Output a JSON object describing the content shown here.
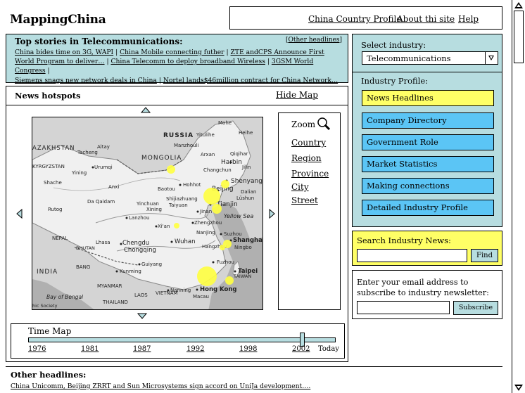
{
  "site": {
    "logo": "MappingChina"
  },
  "nav": {
    "links": [
      "China Country Profile",
      "About thi site",
      "Help"
    ]
  },
  "top_stories": {
    "title": "Top stories in Telecommunications:",
    "other_link": "Other headlines",
    "headlines": [
      "China bides time on 3G, WAPI",
      "China Mobile connecting futher",
      "ZTE andCPS Announce First World Program to deliver…",
      "China Telecomm to deploy broadband Wireless",
      "3GSM World Congress",
      "Siemens snags new network deals in China",
      "Nortel lands$46million contract for China Network…"
    ]
  },
  "hotspots": {
    "title": "News hotspots",
    "hide_map": "Hide Map",
    "zoom": {
      "label": "Zoom",
      "options": [
        "Country",
        "Region",
        "Province",
        "City",
        "Street"
      ]
    },
    "timemap": {
      "label": "Time Map",
      "years": [
        "1976",
        "1981",
        "1987",
        "1992",
        "1998",
        "2002"
      ],
      "today": "Today",
      "selected": "2002"
    },
    "map": {
      "countries": [
        "RUSSIA",
        "MONGOLIA",
        "AZAKHSTAN",
        "KYRGYZSTAN",
        "NEPAL",
        "BHUTAN",
        "INDIA",
        "BANG",
        "MYANMAR",
        "LAOS",
        "THAILAND",
        "VIETNAM",
        "TAIWAN"
      ],
      "cities": [
        "Harbin",
        "Shenyang",
        "Beijing",
        "Tianjin",
        "Shijiazhuang",
        "Taiyuan",
        "Jinan",
        "Zhengzhou",
        "Xi'an",
        "Lanzhou",
        "Xining",
        "Yinchuan",
        "Hohhot",
        "Baotou",
        "Changchun",
        "Jilin",
        "Qiqihar",
        "Heihe",
        "Mohe",
        "Manzhouli",
        "Yitulihe",
        "Arxan",
        "Urumqi",
        "Altay",
        "Tacheng",
        "Yining",
        "Anxi",
        "Da Qaidam",
        "Shache",
        "Rutog",
        "Lhasa",
        "Chengdu",
        "Chongqing",
        "Wuhan",
        "Nanjing",
        "Suzhou",
        "Shanghai",
        "Hangzhou",
        "Ningbo",
        "Fuzhou",
        "Taipei",
        "Guiyang",
        "Kunming",
        "Nanning",
        "Hong Kong",
        "Macau",
        "Lüshun",
        "Dalian"
      ],
      "seas": [
        "Bay of Bengal",
        "Yellow Sea"
      ],
      "credit": "hic Society",
      "hotspots": [
        {
          "name": "Beijing",
          "size": "large"
        },
        {
          "name": "Tianjin",
          "size": "medium"
        },
        {
          "name": "Shenyang",
          "size": "small"
        },
        {
          "name": "Shanghai",
          "size": "medium"
        },
        {
          "name": "Hong Kong",
          "size": "large"
        },
        {
          "name": "Xi'an",
          "size": "small"
        },
        {
          "name": "Western China",
          "size": "small"
        }
      ],
      "hotspot_color": "#ffff44"
    }
  },
  "other_headlines": {
    "title": "Other headlines:",
    "text": "China Unicomm, Beijing ZRRT and Sun Microsystems sign accord on UniJa development…."
  },
  "industry": {
    "select_label": "Select industry:",
    "selected": "Telecommunications",
    "profile_label": "Industry Profile:",
    "profile_items": [
      "News Headlines",
      "Company Directory",
      "Government Role",
      "Market Statistics",
      "Making connections",
      "Detailed Industry Profile"
    ],
    "active_item": "News Headlines"
  },
  "search": {
    "label": "Search Industry News:",
    "button": "Find",
    "value": ""
  },
  "newsletter": {
    "label": "Enter your email address to subscribe to industry newsletter:",
    "button": "Subscribe",
    "value": ""
  },
  "colors": {
    "panel_teal": "#b7dde0",
    "button_blue": "#5bc5f5",
    "highlight_yellow": "#ffff66"
  }
}
